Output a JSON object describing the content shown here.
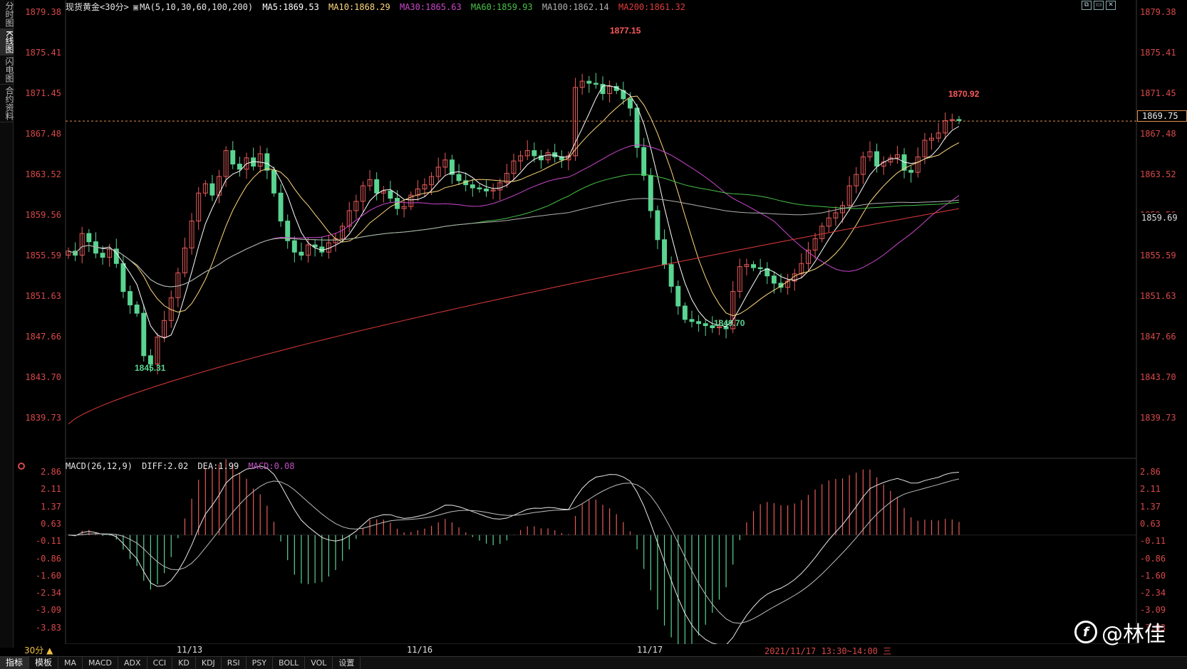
{
  "left_tabs": [
    {
      "label": "分时图",
      "active": false
    },
    {
      "label": "K线图",
      "active": true
    },
    {
      "label": "闪电图",
      "active": false
    },
    {
      "label": "合约资料",
      "active": false
    }
  ],
  "legend": {
    "symbol": "现货黄金<30分>",
    "ma_params": "MA(5,10,30,60,100,200)",
    "ma5": "MA5:1869.53",
    "ma10": "MA10:1868.29",
    "ma30": "MA30:1865.63",
    "ma60": "MA60:1859.93",
    "ma100": "MA100:1862.14",
    "ma200": "MA200:1861.32"
  },
  "macd_legend": {
    "params": "MACD(26,12,9)",
    "diff": "DIFF:2.02",
    "dea": "DEA:1.99",
    "macd": "MACD:0.08"
  },
  "price_axis": [
    "1879.38",
    "1875.41",
    "1871.45",
    "1867.48",
    "1863.52",
    "1859.56",
    "1855.59",
    "1851.63",
    "1847.66",
    "1843.70",
    "1839.73"
  ],
  "macd_axis": [
    "2.86",
    "2.11",
    "1.37",
    "0.63",
    "-0.11",
    "-0.86",
    "-1.60",
    "-2.34",
    "-3.09",
    "-3.83"
  ],
  "annotations": {
    "high": "1877.15",
    "recent_high": "1870.92",
    "low1": "1845.31",
    "low2": "1849.70"
  },
  "current_price": "1869.75",
  "ma60_marker": "1859.69",
  "dates": [
    "11/13",
    "11/16",
    "11/17"
  ],
  "time_readout": "2021/11/17 13:30~14:00 三",
  "period": "30分 ▲",
  "bottom_tabs": [
    "指标",
    "模板",
    "MA",
    "MACD",
    "ADX",
    "CCI",
    "KD",
    "KDJ",
    "RSI",
    "PSY",
    "BOLL",
    "VOL",
    "设置"
  ],
  "watermark": "@林佳",
  "colors": {
    "up": "#5ad491",
    "down": "#e65a5a",
    "axis_text": "#d84848",
    "ma5": "#ffffff",
    "ma10": "#ffd87c",
    "ma30": "#cc46cc",
    "ma60": "#47c347",
    "ma100": "#b0b0b0",
    "ma200": "#e03b3b",
    "macd_label": "#c050c0"
  },
  "chart_data": {
    "type": "candlestick",
    "ylim": [
      1838.5,
      1880.2
    ],
    "highlighted_prices": {
      "high": 1877.15,
      "recent_high": 1870.92,
      "low1": 1845.31,
      "low2": 1849.7,
      "current": 1869.75
    },
    "close_series": [
      1857.2,
      1856.8,
      1858.9,
      1858.1,
      1857.0,
      1856.6,
      1857.4,
      1856.0,
      1853.3,
      1852.0,
      1851.2,
      1847.1,
      1846.3,
      1848.9,
      1850.5,
      1852.7,
      1855.1,
      1857.5,
      1860.1,
      1862.8,
      1863.7,
      1862.6,
      1864.4,
      1866.9,
      1865.6,
      1865.1,
      1866.2,
      1865.4,
      1866.6,
      1865.0,
      1862.8,
      1860.1,
      1858.2,
      1857.1,
      1856.8,
      1857.8,
      1857.6,
      1857.1,
      1858.0,
      1858.4,
      1859.6,
      1861.1,
      1862.0,
      1863.5,
      1864.1,
      1862.8,
      1863.0,
      1862.3,
      1861.3,
      1861.5,
      1862.6,
      1863.2,
      1863.6,
      1864.4,
      1865.3,
      1866.0,
      1864.6,
      1864.0,
      1863.6,
      1863.3,
      1863.2,
      1863.0,
      1863.1,
      1863.8,
      1864.7,
      1865.9,
      1866.4,
      1866.9,
      1866.4,
      1866.0,
      1866.7,
      1866.3,
      1866.0,
      1866.4,
      1873.0,
      1873.6,
      1873.4,
      1873.3,
      1872.4,
      1873.1,
      1872.7,
      1871.9,
      1871.0,
      1867.2,
      1864.5,
      1861.1,
      1858.3,
      1855.9,
      1853.8,
      1851.9,
      1850.6,
      1850.4,
      1850.2,
      1850.0,
      1849.8,
      1849.9,
      1849.7,
      1853.3,
      1855.7,
      1855.9,
      1855.6,
      1855.5,
      1854.8,
      1854.1,
      1853.7,
      1854.3,
      1855.0,
      1856.0,
      1857.3,
      1858.4,
      1859.6,
      1860.4,
      1860.9,
      1861.6,
      1863.5,
      1864.6,
      1866.3,
      1866.8,
      1865.4,
      1865.8,
      1866.2,
      1866.5,
      1865.0,
      1864.8,
      1866.3,
      1867.9,
      1868.1,
      1868.6,
      1869.8,
      1869.9,
      1869.8
    ]
  }
}
